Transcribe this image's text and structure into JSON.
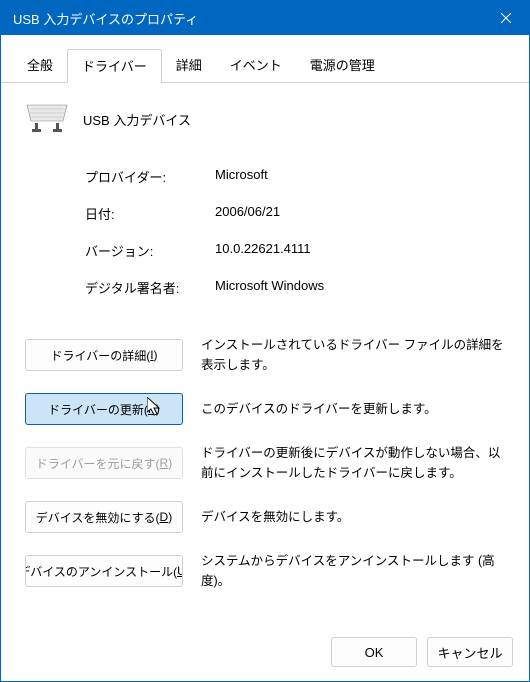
{
  "title": "USB 入力デバイスのプロパティ",
  "tabs": {
    "general": "全般",
    "driver": "ドライバー",
    "details": "詳細",
    "events": "イベント",
    "power": "電源の管理"
  },
  "device": {
    "name": "USB 入力デバイス"
  },
  "info": {
    "provider_label": "プロバイダー:",
    "provider_value": "Microsoft",
    "date_label": "日付:",
    "date_value": "2006/06/21",
    "version_label": "バージョン:",
    "version_value": "10.0.22621.4111",
    "signer_label": "デジタル署名者:",
    "signer_value": "Microsoft Windows"
  },
  "actions": {
    "details_label_pre": "ドライバーの詳細(",
    "details_key": "I",
    "details_label_post": ")",
    "details_desc": "インストールされているドライバー ファイルの詳細を表示します。",
    "update_label_pre": "ドライバーの更新(",
    "update_key": "P",
    "update_label_post": ")",
    "update_desc": "このデバイスのドライバーを更新します。",
    "rollback_label_pre": "ドライバーを元に戻す(",
    "rollback_key": "R",
    "rollback_label_post": ")",
    "rollback_desc": "ドライバーの更新後にデバイスが動作しない場合、以前にインストールしたドライバーに戻します。",
    "disable_label_pre": "デバイスを無効にする(",
    "disable_key": "D",
    "disable_label_post": ")",
    "disable_desc": "デバイスを無効にします。",
    "uninstall_label_pre": "デバイスのアンインストール(",
    "uninstall_key": "U",
    "uninstall_label_post": ")",
    "uninstall_desc": "システムからデバイスをアンインストールします (高度)。"
  },
  "footer": {
    "ok": "OK",
    "cancel": "キャンセル"
  }
}
